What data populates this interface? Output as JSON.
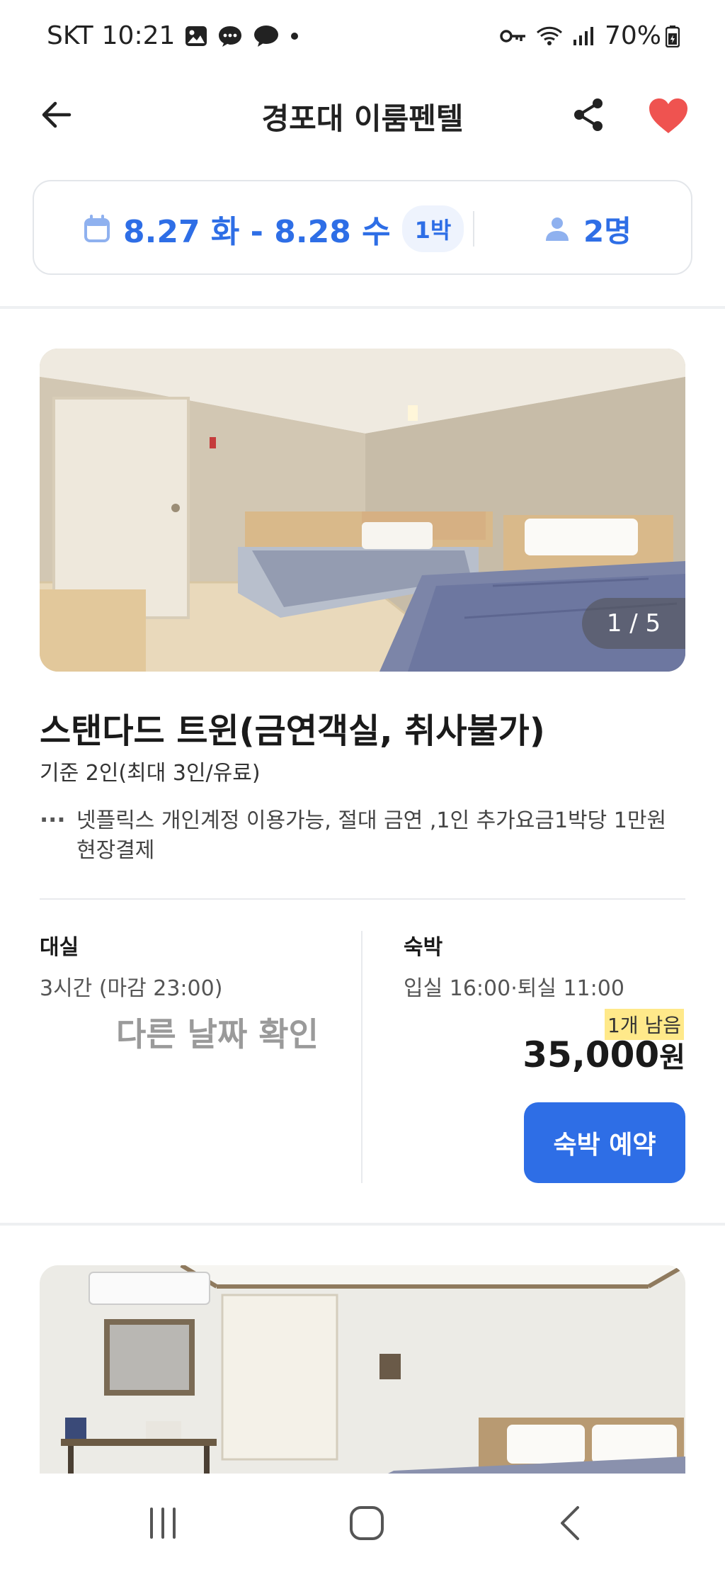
{
  "status_bar": {
    "carrier": "SKT",
    "time": "10:21",
    "battery": "70%"
  },
  "header": {
    "title": "경포대 이룸펜텔",
    "back_icon": "arrow-left-icon",
    "share_icon": "share-icon",
    "favorite_icon": "heart-icon",
    "favorite_color": "#ef5350"
  },
  "search": {
    "dates": "8.27 화 - 8.28 수",
    "nights": "1박",
    "guests": "2명",
    "accent_color": "#2e6ee6"
  },
  "room": {
    "photo_counter": "1 / 5",
    "name": "스탠다드 트윈(금연객실, 취사불가)",
    "capacity": "기준 2인(최대 3인/유료)",
    "amenities_dots": "···",
    "amenities": "넷플릭스 개인계정 이용가능, 절대 금연 ,1인 추가요금1박당 1만원 현장결제",
    "dayuse": {
      "label": "대실",
      "info": "3시간 (마감 23:00)",
      "action": "다른 날짜 확인"
    },
    "overnight": {
      "label": "숙박",
      "info": "입실 16:00·퇴실 11:00",
      "remaining": "1개 남음",
      "price": "35,000",
      "currency": "원",
      "button": "숙박 예약"
    }
  },
  "nav": {
    "recents_icon": "recents-icon",
    "home_icon": "home-icon",
    "back_icon": "nav-back-icon"
  }
}
